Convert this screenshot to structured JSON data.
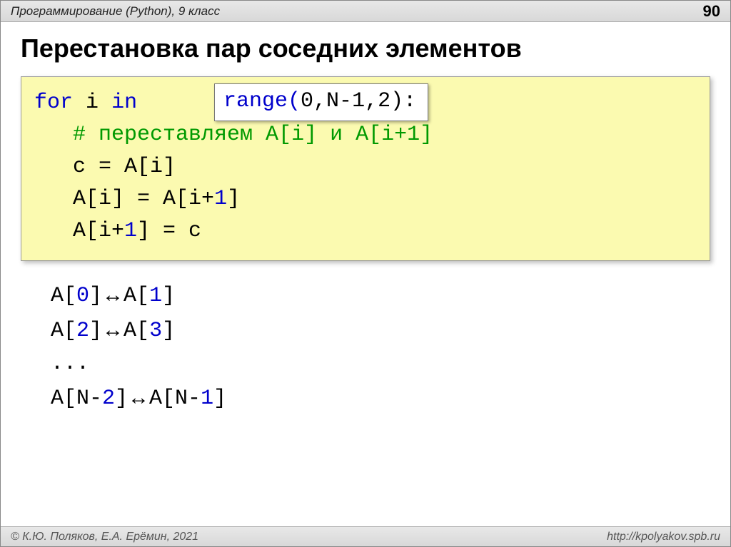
{
  "header": {
    "left": "Программирование (Python), 9 класс",
    "page": "90"
  },
  "title": "Перестановка пар соседних элементов",
  "code": {
    "kw_for": "for",
    "kw_in": "in",
    "var_i": "i",
    "comment": "# переставляем A[i] и A[i+1]",
    "l3": "c = A[i]",
    "l4a": "A[i] = A[i+",
    "l4n": "1",
    "l4b": "]",
    "l5a": "A[i+",
    "l5n": "1",
    "l5b": "] = c"
  },
  "overlay": {
    "fn_open": "range(",
    "a0": "0",
    "c1": ",N-",
    "a1": "1",
    "c2": ",",
    "a2": "2",
    "close": "):"
  },
  "swaps": {
    "l1a": "A[",
    "l1n1": "0",
    "l1m": "]",
    "l1b": "A[",
    "l1n2": "1",
    "l1c": "]",
    "l2a": "A[",
    "l2n1": "2",
    "l2m": "]",
    "l2b": "A[",
    "l2n2": "3",
    "l2c": "]",
    "dots": "...",
    "l4a": "A[N-",
    "l4n1": "2",
    "l4m": "]",
    "l4b": "A[N-",
    "l4n2": "1",
    "l4c": "]",
    "arrow": "↔"
  },
  "footer": {
    "left": "© К.Ю. Поляков, Е.А. Ерёмин, 2021",
    "right": "http://kpolyakov.spb.ru"
  }
}
